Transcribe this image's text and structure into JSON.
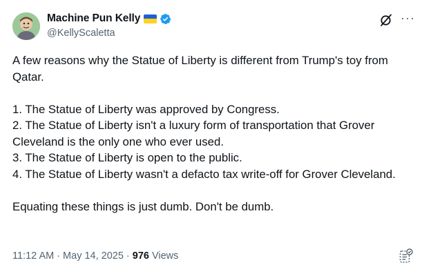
{
  "author": {
    "display_name": "Machine Pun Kelly",
    "handle": "@KellyScaletta",
    "avatar_icon": "avatar-illustration-icon",
    "flag_icon": "ukraine-flag-icon",
    "verified_icon": "verified-badge-icon"
  },
  "actions": {
    "grok_icon": "grok-icon",
    "more_label": "···"
  },
  "tweet": {
    "intro": "A few reasons why the Statue of Liberty is different from Trump's toy from Qatar.",
    "points": [
      "1. The Statue of Liberty was approved by Congress.",
      "2. The Statue of Liberty isn't a luxury form of transportation that Grover Cleveland is the only one who ever used.",
      "3. The Statue of Liberty is open to the public.",
      "4. The Statue of Liberty wasn't a defacto tax write-off for Grover Cleveland."
    ],
    "closing": "Equating these things is just dumb. Don't be dumb."
  },
  "meta": {
    "time": "11:12 AM",
    "separator": "·",
    "date": "May 14, 2025",
    "views_count": "976",
    "views_label": "Views",
    "summary_icon": "post-summary-icon"
  },
  "colors": {
    "text": "#0f1419",
    "secondary": "#536471",
    "verified": "#1d9bf0",
    "flag_blue": "#1f5fd6",
    "flag_yellow": "#ffd21f"
  }
}
